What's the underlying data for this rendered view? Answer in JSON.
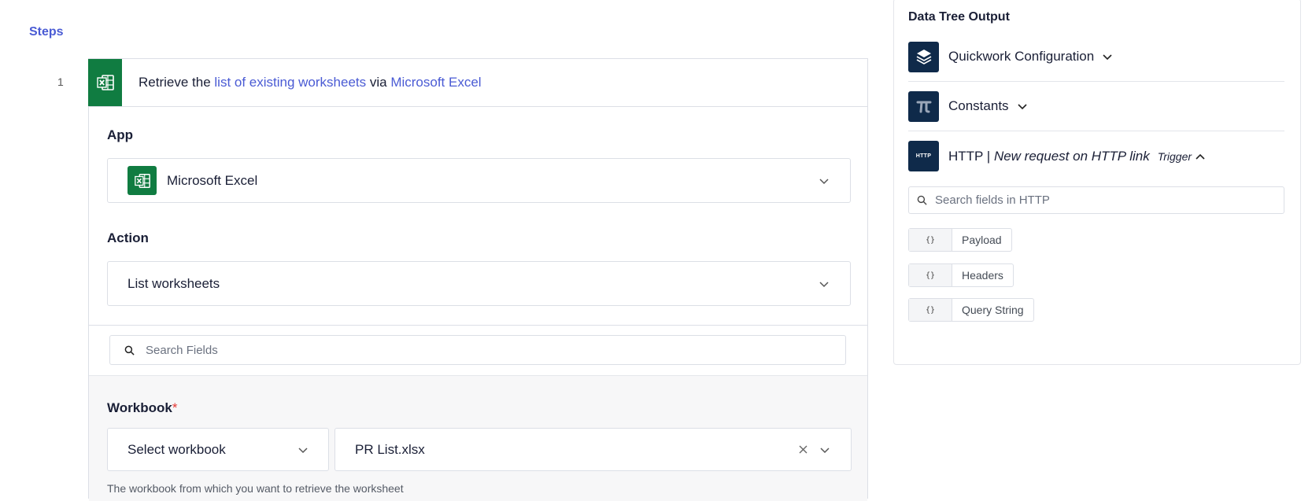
{
  "steps_heading": "Steps",
  "step": {
    "number": "1",
    "header": {
      "prefix": "Retrieve the ",
      "link1": "list of existing worksheets",
      "middle": " via ",
      "link2": "Microsoft Excel"
    },
    "app": {
      "label": "App",
      "value": "Microsoft Excel"
    },
    "action": {
      "label": "Action",
      "value": "List worksheets"
    },
    "search": {
      "placeholder": "Search Fields"
    },
    "workbook": {
      "label": "Workbook",
      "required_mark": "*",
      "mode": "Select workbook",
      "value": "PR List.xlsx",
      "help": "The workbook from which you want to retrieve the worksheet"
    }
  },
  "data_tree": {
    "title": "Data Tree Output",
    "nodes": [
      {
        "label": "Quickwork Configuration",
        "icon": "layers-icon",
        "expanded": false
      },
      {
        "label": "Constants",
        "icon": "pi-icon",
        "expanded": false
      },
      {
        "label_main": "HTTP | ",
        "label_italic": "New request on HTTP link",
        "icon_text": "HTTP",
        "badge": "Trigger",
        "expanded": true
      }
    ],
    "search": {
      "placeholder": "Search fields in HTTP"
    },
    "fields": [
      {
        "brace": "{}",
        "label": "Payload"
      },
      {
        "brace": "{}",
        "label": "Headers"
      },
      {
        "brace": "{}",
        "label": "Query String"
      }
    ]
  },
  "colors": {
    "accent": "#4a5bd4",
    "excel_green": "#107c41",
    "node_dark": "#0f2a4a",
    "required": "#e53935"
  }
}
